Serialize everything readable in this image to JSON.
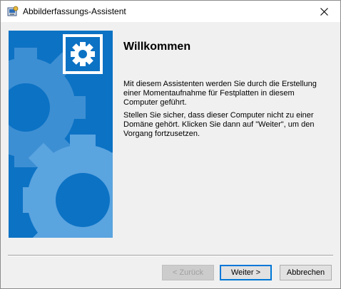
{
  "window": {
    "title": "Abbilderfassungs-Assistent",
    "icon": "app-wizard-icon",
    "close_icon": "close-icon"
  },
  "banner": {
    "background_color": "#0c72c4",
    "icon": "gear-icon"
  },
  "main": {
    "heading": "Willkommen",
    "paragraph1": "Mit diesem Assistenten werden Sie durch die Erstellung einer Momentaufnahme für Festplatten in diesem Computer geführt.",
    "paragraph2": "Stellen Sie sicher, dass dieser Computer nicht zu einer Domäne gehört. Klicken Sie dann auf \"Weiter\", um den Vorgang fortzusetzen."
  },
  "buttons": {
    "back_label": "< Zurück",
    "next_label": "Weiter >",
    "cancel_label": "Abbrechen"
  },
  "colors": {
    "accent": "#0078d7"
  }
}
